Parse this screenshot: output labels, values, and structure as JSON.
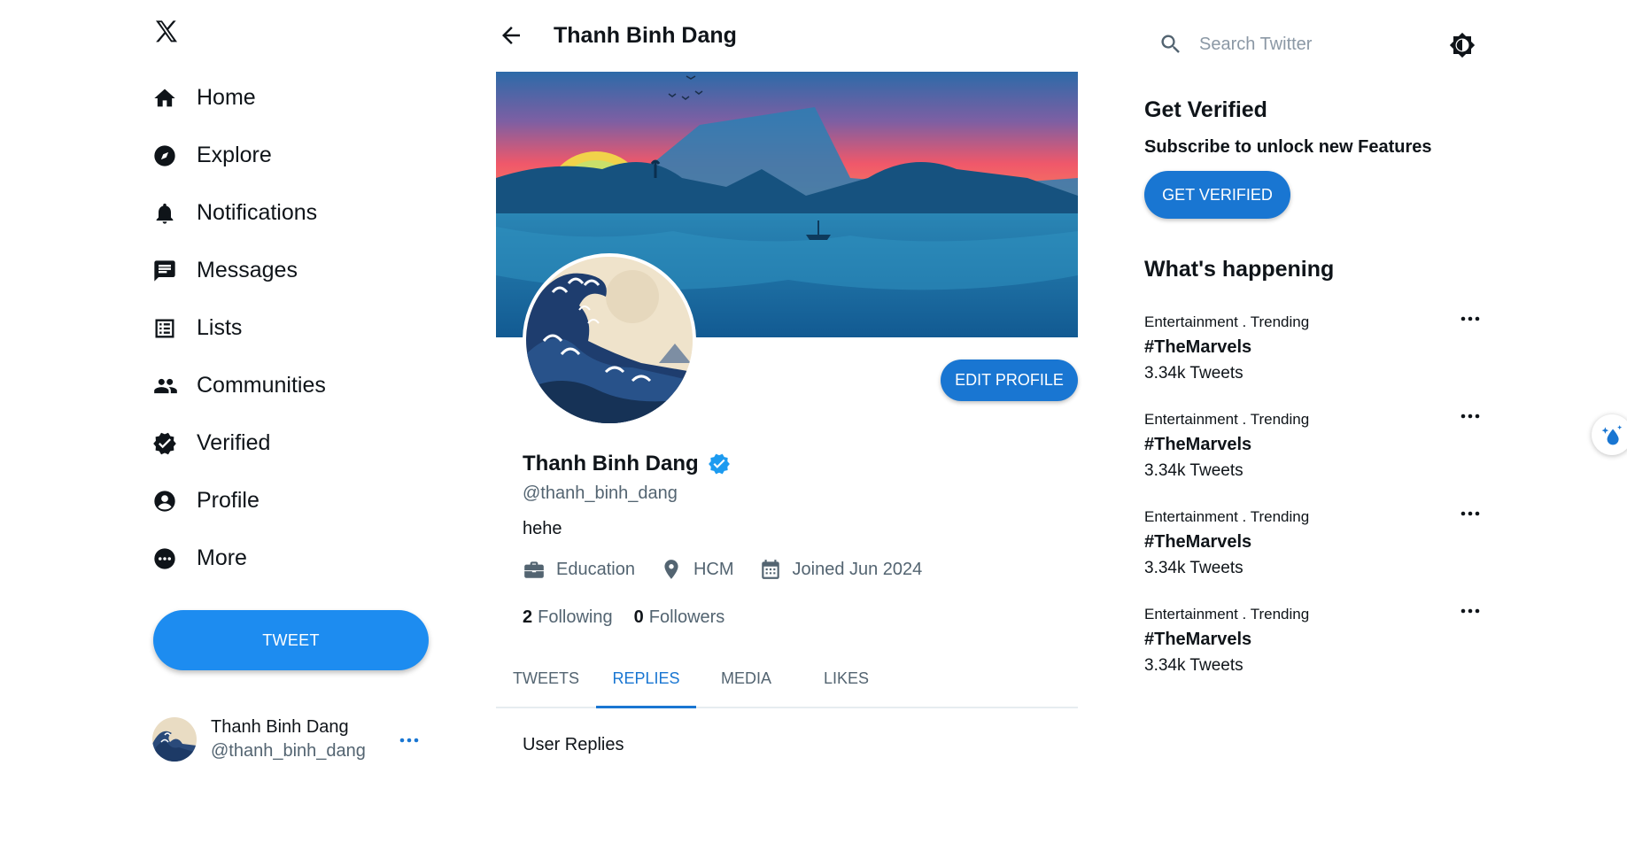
{
  "sidebar": {
    "logo_icon": "x-logo-icon",
    "items": [
      {
        "label": "Home",
        "icon": "home-icon"
      },
      {
        "label": "Explore",
        "icon": "compass-icon"
      },
      {
        "label": "Notifications",
        "icon": "bell-icon"
      },
      {
        "label": "Messages",
        "icon": "message-icon"
      },
      {
        "label": "Lists",
        "icon": "list-icon"
      },
      {
        "label": "Communities",
        "icon": "people-icon"
      },
      {
        "label": "Verified",
        "icon": "verified-icon"
      },
      {
        "label": "Profile",
        "icon": "user-icon"
      },
      {
        "label": "More",
        "icon": "more-icon"
      }
    ],
    "tweet_label": "TWEET",
    "account": {
      "name": "Thanh Binh Dang",
      "handle": "@thanh_binh_dang"
    }
  },
  "header": {
    "title": "Thanh Binh Dang"
  },
  "profile": {
    "edit_label": "EDIT PROFILE",
    "name": "Thanh Binh Dang",
    "handle": "@thanh_binh_dang",
    "bio": "hehe",
    "category": "Education",
    "location": "HCM",
    "joined": "Joined Jun 2024",
    "following_count": "2",
    "following_label": "Following",
    "followers_count": "0",
    "followers_label": "Followers"
  },
  "tabs": [
    {
      "label": "TWEETS",
      "active": false
    },
    {
      "label": "REPLIES",
      "active": true
    },
    {
      "label": "MEDIA",
      "active": false
    },
    {
      "label": "LIKES",
      "active": false
    }
  ],
  "tab_content": "User Replies",
  "search": {
    "placeholder": "Search Twitter"
  },
  "get_verified": {
    "title": "Get Verified",
    "subtitle": "Subscribe to unlock new Features",
    "button": "GET VERIFIED"
  },
  "whats_happening": {
    "title": "What's happening",
    "trends": [
      {
        "category": "Entertainment . Trending",
        "tag": "#TheMarvels",
        "count": "3.34k Tweets"
      },
      {
        "category": "Entertainment . Trending",
        "tag": "#TheMarvels",
        "count": "3.34k Tweets"
      },
      {
        "category": "Entertainment . Trending",
        "tag": "#TheMarvels",
        "count": "3.34k Tweets"
      },
      {
        "category": "Entertainment . Trending",
        "tag": "#TheMarvels",
        "count": "3.34k Tweets"
      }
    ]
  },
  "colors": {
    "accent": "#1976d2",
    "tweet_button": "#1d8cf0",
    "text": "#0f1419",
    "muted": "#536471"
  }
}
